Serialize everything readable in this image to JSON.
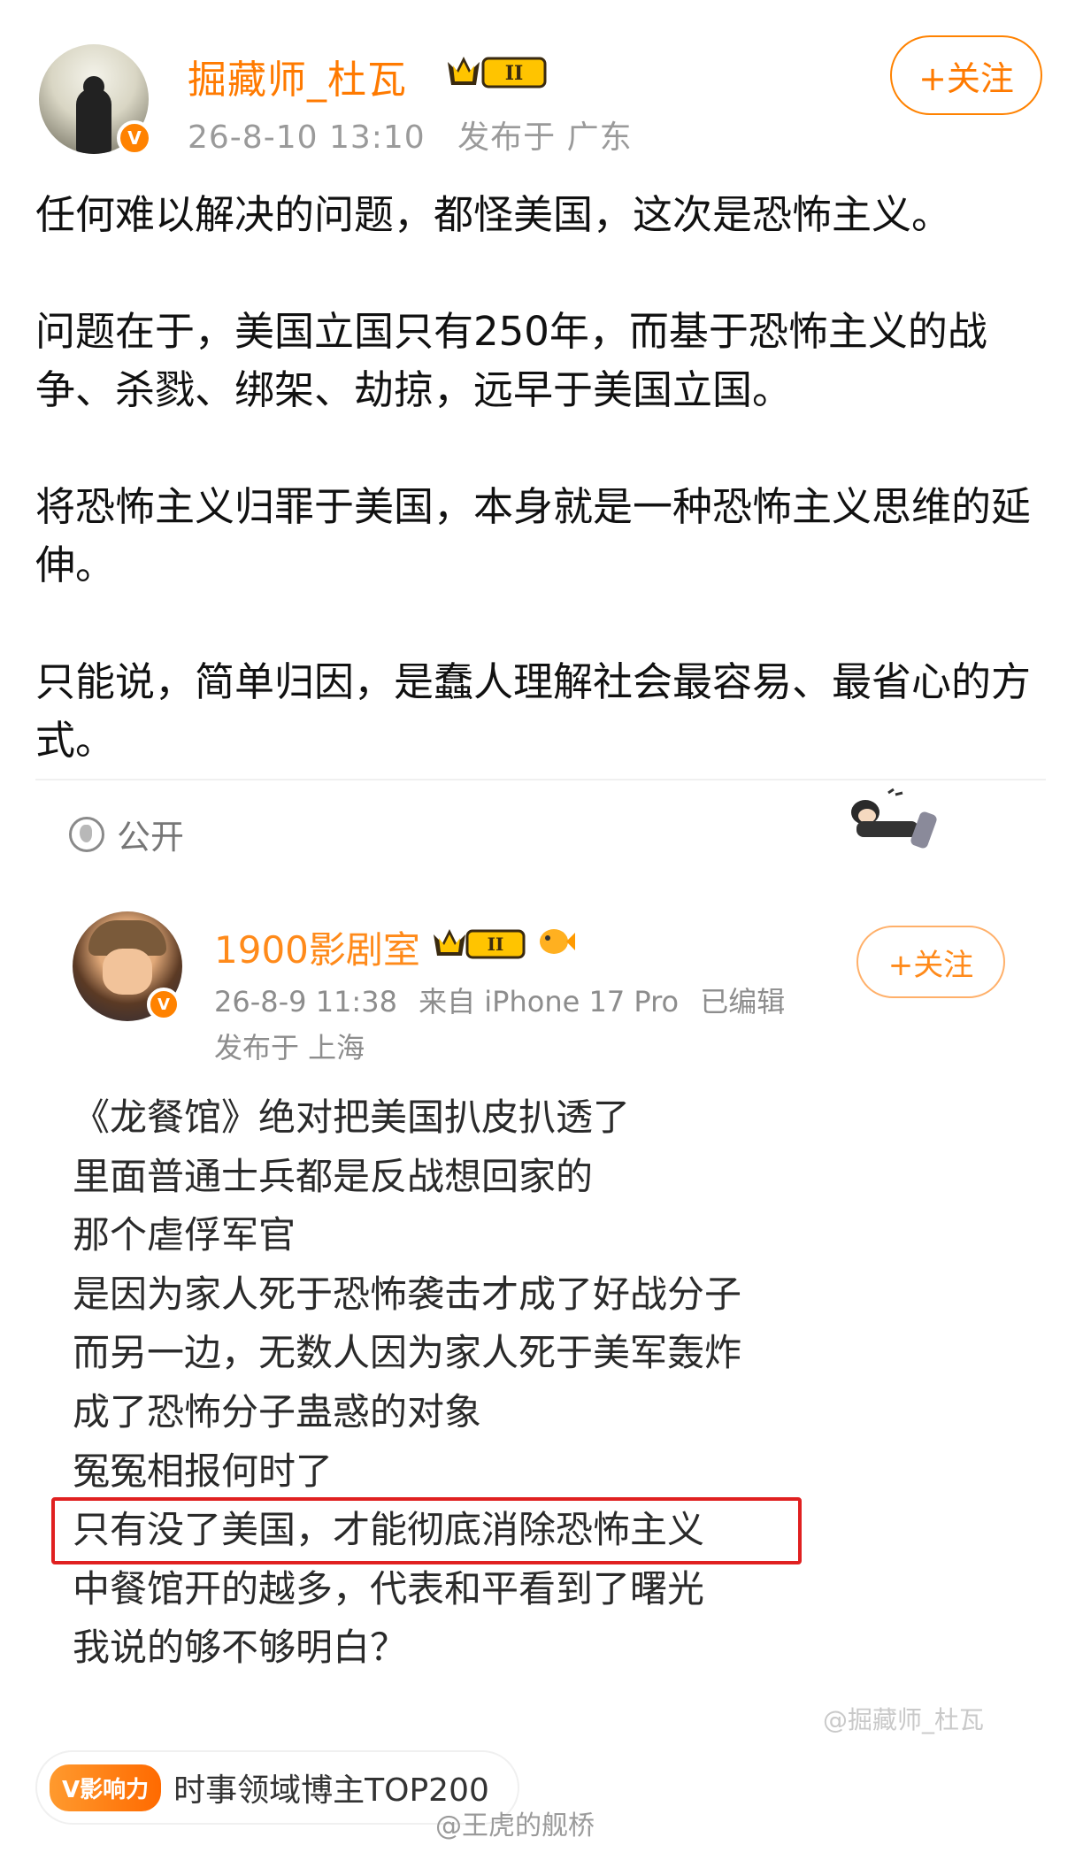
{
  "post": {
    "username": "掘藏师_杜瓦",
    "timestamp": "26-8-10 13:10",
    "location": "发布于 广东",
    "follow_label": "+关注",
    "level_badge": "II",
    "verified_badge": "V",
    "paragraphs": [
      "任何难以解决的问题，都怪美国，这次是恐怖主义。",
      "问题在于，美国立国只有250年，而基于恐怖主义的战争、杀戮、绑架、劫掠，远早于美国立国。",
      "将恐怖主义归罪于美国，本身就是一种恐怖主义思维的延伸。",
      "只能说，简单归因，是蠢人理解社会最容易、最省心的方式。"
    ],
    "visibility": "公开"
  },
  "quoted": {
    "username": "1900影剧室",
    "level_badge": "II",
    "verified_badge": "V",
    "timestamp": "26-8-9 11:38",
    "device": "来自 iPhone 17 Pro",
    "edited": "已编辑",
    "location": "发布于 上海",
    "follow_label": "+关注",
    "lines": [
      "《龙餐馆》绝对把美国扒皮扒透了",
      "里面普通士兵都是反战想回家的",
      "那个虐俘军官",
      "是因为家人死于恐怖袭击才成了好战分子",
      "而另一边，无数人因为家人死于美军轰炸",
      "成了恐怖分子蛊惑的对象",
      "冤冤相报何时了",
      "只有没了美国，才能彻底消除恐怖主义",
      "中餐馆开的越多，代表和平看到了曙光",
      "我说的够不够明白？"
    ],
    "highlighted_line_index": 7,
    "watermark": "@掘藏师_杜瓦"
  },
  "footer": {
    "influence_badge": "V影响力",
    "influence_text": "时事领域博主TOP200",
    "watermark": "@王虎的舰桥"
  },
  "colors": {
    "accent": "#ff7a00",
    "highlight": "#e02020",
    "meta_text": "#9a9a9a"
  },
  "icons": [
    "globe-icon",
    "crown-level-icon",
    "verified-icon",
    "fish-icon",
    "sticker-icon"
  ]
}
